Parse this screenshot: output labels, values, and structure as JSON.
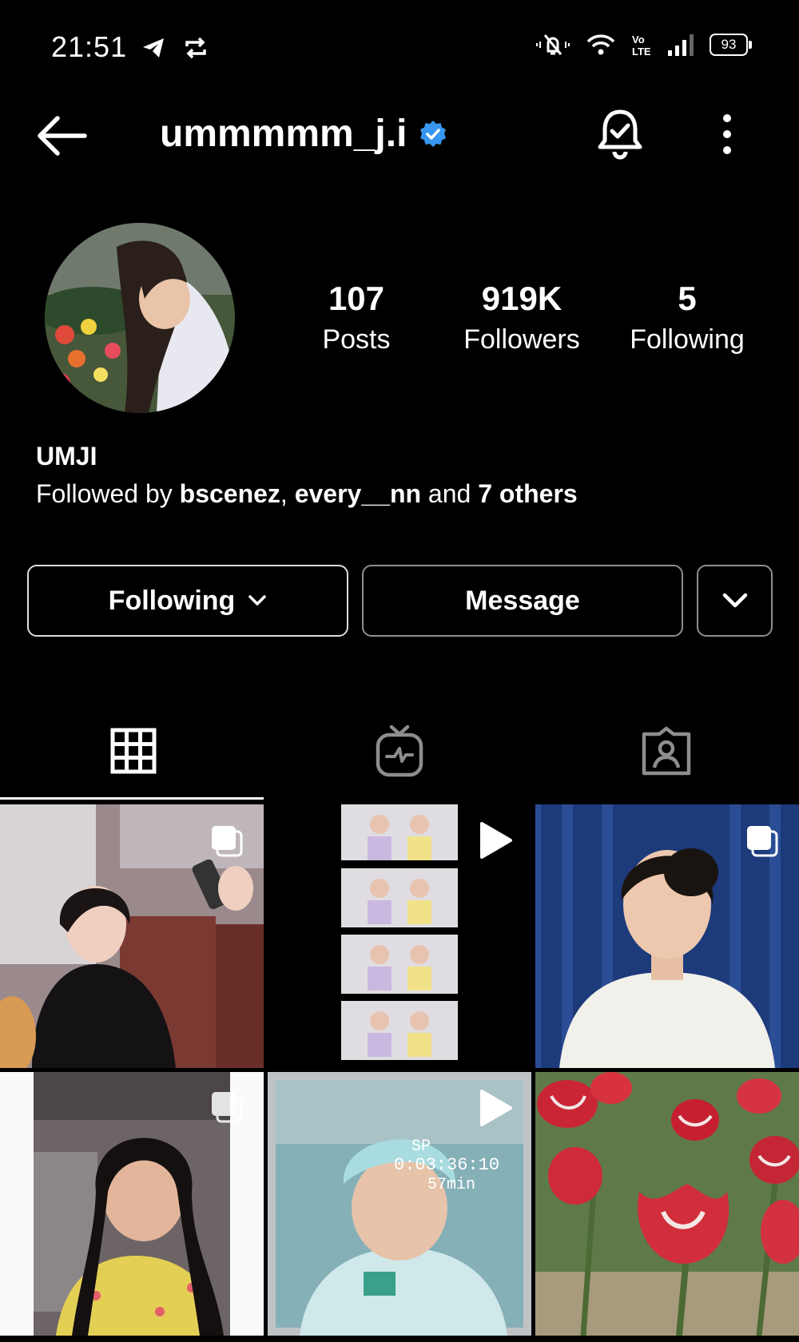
{
  "status_bar": {
    "time": "21:51",
    "battery": "93"
  },
  "header": {
    "username": "ummmmm_j.i"
  },
  "stats": {
    "posts": {
      "value": "107",
      "label": "Posts"
    },
    "followers": {
      "value": "919K",
      "label": "Followers"
    },
    "following": {
      "value": "5",
      "label": "Following"
    }
  },
  "profile": {
    "name": "UMJI",
    "followed_prefix": "Followed by ",
    "follower1": "bscenez",
    "sep": ", ",
    "follower2": "every__nn",
    "and_text": " and ",
    "others": "7 others"
  },
  "buttons": {
    "following": "Following",
    "message": "Message"
  },
  "tabs": [
    "grid-icon",
    "igtv-icon",
    "tagged-icon"
  ],
  "icons": [
    "back-arrow-icon",
    "verified-badge-icon",
    "notification-bell-icon",
    "more-options-icon",
    "carousel-icon",
    "play-icon"
  ],
  "colors": {
    "verified": "#3797f0",
    "background": "#000000"
  },
  "grid": [
    {
      "type": "carousel"
    },
    {
      "type": "video"
    },
    {
      "type": "carousel"
    },
    {
      "type": "carousel"
    },
    {
      "type": "video"
    },
    {
      "type": "photo"
    }
  ]
}
